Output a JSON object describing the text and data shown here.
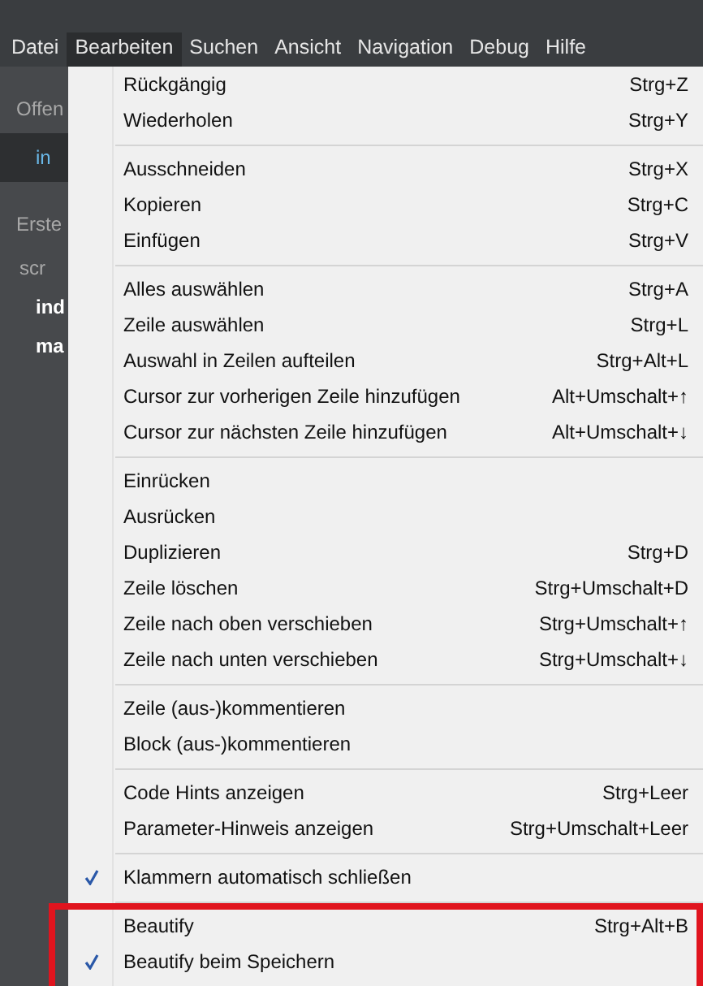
{
  "menubar": [
    {
      "label": "Datei",
      "selected": false
    },
    {
      "label": "Bearbeiten",
      "selected": true
    },
    {
      "label": "Suchen",
      "selected": false
    },
    {
      "label": "Ansicht",
      "selected": false
    },
    {
      "label": "Navigation",
      "selected": false
    },
    {
      "label": "Debug",
      "selected": false
    },
    {
      "label": "Hilfe",
      "selected": false
    }
  ],
  "sidebar": {
    "sections": [
      {
        "title": "Offen",
        "files": [
          {
            "label": "in",
            "kind": "active"
          }
        ]
      },
      {
        "title": "Erste",
        "files": [
          {
            "label": "scr",
            "kind": "folder"
          },
          {
            "label": "ind",
            "kind": "file"
          },
          {
            "label": "ma",
            "kind": "file"
          }
        ]
      }
    ]
  },
  "menu": {
    "groups": [
      {
        "highlighted": false,
        "items": [
          {
            "label": "Rückgängig",
            "shortcut": "Strg+Z",
            "checked": false
          },
          {
            "label": "Wiederholen",
            "shortcut": "Strg+Y",
            "checked": false
          }
        ]
      },
      {
        "highlighted": false,
        "items": [
          {
            "label": "Ausschneiden",
            "shortcut": "Strg+X",
            "checked": false
          },
          {
            "label": "Kopieren",
            "shortcut": "Strg+C",
            "checked": false
          },
          {
            "label": "Einfügen",
            "shortcut": "Strg+V",
            "checked": false
          }
        ]
      },
      {
        "highlighted": false,
        "items": [
          {
            "label": "Alles auswählen",
            "shortcut": "Strg+A",
            "checked": false
          },
          {
            "label": "Zeile auswählen",
            "shortcut": "Strg+L",
            "checked": false
          },
          {
            "label": "Auswahl in Zeilen aufteilen",
            "shortcut": "Strg+Alt+L",
            "checked": false
          },
          {
            "label": "Cursor zur vorherigen Zeile hinzufügen",
            "shortcut": "Alt+Umschalt+↑",
            "checked": false
          },
          {
            "label": "Cursor zur nächsten Zeile hinzufügen",
            "shortcut": "Alt+Umschalt+↓",
            "checked": false
          }
        ]
      },
      {
        "highlighted": false,
        "items": [
          {
            "label": "Einrücken",
            "checked": false
          },
          {
            "label": "Ausrücken",
            "checked": false
          },
          {
            "label": "Duplizieren",
            "shortcut": "Strg+D",
            "checked": false
          },
          {
            "label": "Zeile löschen",
            "shortcut": "Strg+Umschalt+D",
            "checked": false
          },
          {
            "label": "Zeile nach oben verschieben",
            "shortcut": "Strg+Umschalt+↑",
            "checked": false
          },
          {
            "label": "Zeile nach unten verschieben",
            "shortcut": "Strg+Umschalt+↓",
            "checked": false
          }
        ]
      },
      {
        "highlighted": false,
        "items": [
          {
            "label": "Zeile (aus-)kommentieren",
            "checked": false
          },
          {
            "label": "Block (aus-)kommentieren",
            "checked": false
          }
        ]
      },
      {
        "highlighted": false,
        "items": [
          {
            "label": "Code Hints anzeigen",
            "shortcut": "Strg+Leer",
            "checked": false
          },
          {
            "label": "Parameter-Hinweis anzeigen",
            "shortcut": "Strg+Umschalt+Leer",
            "checked": false
          }
        ]
      },
      {
        "highlighted": false,
        "items": [
          {
            "label": "Klammern automatisch schließen",
            "checked": true
          }
        ]
      },
      {
        "highlighted": true,
        "items": [
          {
            "label": "Beautify",
            "shortcut": "Strg+Alt+B",
            "checked": false
          },
          {
            "label": "Beautify beim Speichern",
            "checked": true
          }
        ]
      }
    ]
  }
}
